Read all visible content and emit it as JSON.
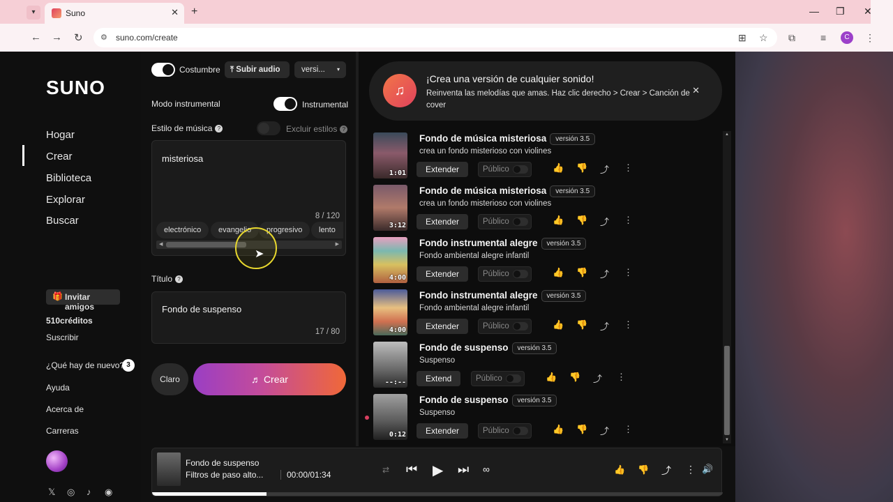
{
  "browser": {
    "tab_title": "Suno",
    "url": "suno.com/create",
    "profile_initial": "C"
  },
  "sidebar": {
    "logo": "SUNO",
    "nav": [
      "Hogar",
      "Crear",
      "Biblioteca",
      "Explorar",
      "Buscar"
    ],
    "invite": "Invitar amigos",
    "credits": "510créditos",
    "subscribe": "Suscribir",
    "whats_new": "¿Qué hay de nuevo?",
    "whats_new_count": "3",
    "help": "Ayuda",
    "about": "Acerca de",
    "careers": "Carreras"
  },
  "form": {
    "custom_label": "Costumbre",
    "upload_audio": "Subir audio",
    "version_select": "versi...",
    "instrumental_mode": "Modo instrumental",
    "instrumental_label": "Instrumental",
    "style_label": "Estilo de música",
    "exclude_styles": "Excluir estilos",
    "style_value": "misteriosa",
    "style_counter": "8 / 120",
    "tags": [
      "electrónico",
      "evangelio",
      "progresivo",
      "lento"
    ],
    "title_label": "Título",
    "title_value": "Fondo de suspenso",
    "title_counter": "17 / 80",
    "clear": "Claro",
    "create": "Crear"
  },
  "promo": {
    "title": "¡Crea una versión de cualquier sonido!",
    "subtitle": "Reinventa las melodías que amas. Haz clic derecho > Crear > Canción de cover"
  },
  "songs": [
    {
      "title": "Fondo de música misteriosa",
      "version": "versión 3.5",
      "desc": "crea un fondo misterioso con violines",
      "duration": "1:01",
      "extend": "Extender",
      "public": "Público"
    },
    {
      "title": "Fondo de música misteriosa",
      "version": "versión 3.5",
      "desc": "crea un fondo misterioso con violines",
      "duration": "3:12",
      "extend": "Extender",
      "public": "Público"
    },
    {
      "title": "Fondo instrumental alegre",
      "version": "versión 3.5",
      "desc": "Fondo ambiental alegre infantil",
      "duration": "4:00",
      "extend": "Extender",
      "public": "Público"
    },
    {
      "title": "Fondo instrumental alegre",
      "version": "versión 3.5",
      "desc": "Fondo ambiental alegre infantil",
      "duration": "4:00",
      "extend": "Extender",
      "public": "Público"
    },
    {
      "title": "Fondo de suspenso",
      "version": "versión 3.5",
      "desc": "Suspenso",
      "duration": "--:--",
      "extend": "Extend",
      "public": "Público"
    },
    {
      "title": "Fondo de suspenso",
      "version": "versión 3.5",
      "desc": "Suspenso",
      "duration": "0:12",
      "extend": "Extender",
      "public": "Público"
    }
  ],
  "player": {
    "title": "Fondo de suspenso",
    "subtitle": "Filtros de paso alto...",
    "time": "00:00/01:34",
    "progress": 0.2
  }
}
